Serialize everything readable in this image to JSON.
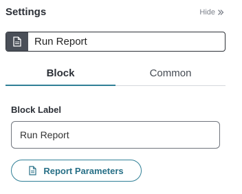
{
  "header": {
    "title": "Settings",
    "hide_label": "Hide",
    "hide_icon": "chevron-double-right-icon"
  },
  "name_field": {
    "icon": "document-icon",
    "value": "Run Report"
  },
  "tabs": [
    {
      "label": "Block",
      "active": true
    },
    {
      "label": "Common",
      "active": false
    }
  ],
  "block_label": {
    "label": "Block Label",
    "value": "Run Report"
  },
  "params_button": {
    "label": "Report Parameters",
    "icon": "document-icon"
  },
  "colors": {
    "accent": "#2f7f96",
    "icon_bg": "#4a4f58"
  }
}
